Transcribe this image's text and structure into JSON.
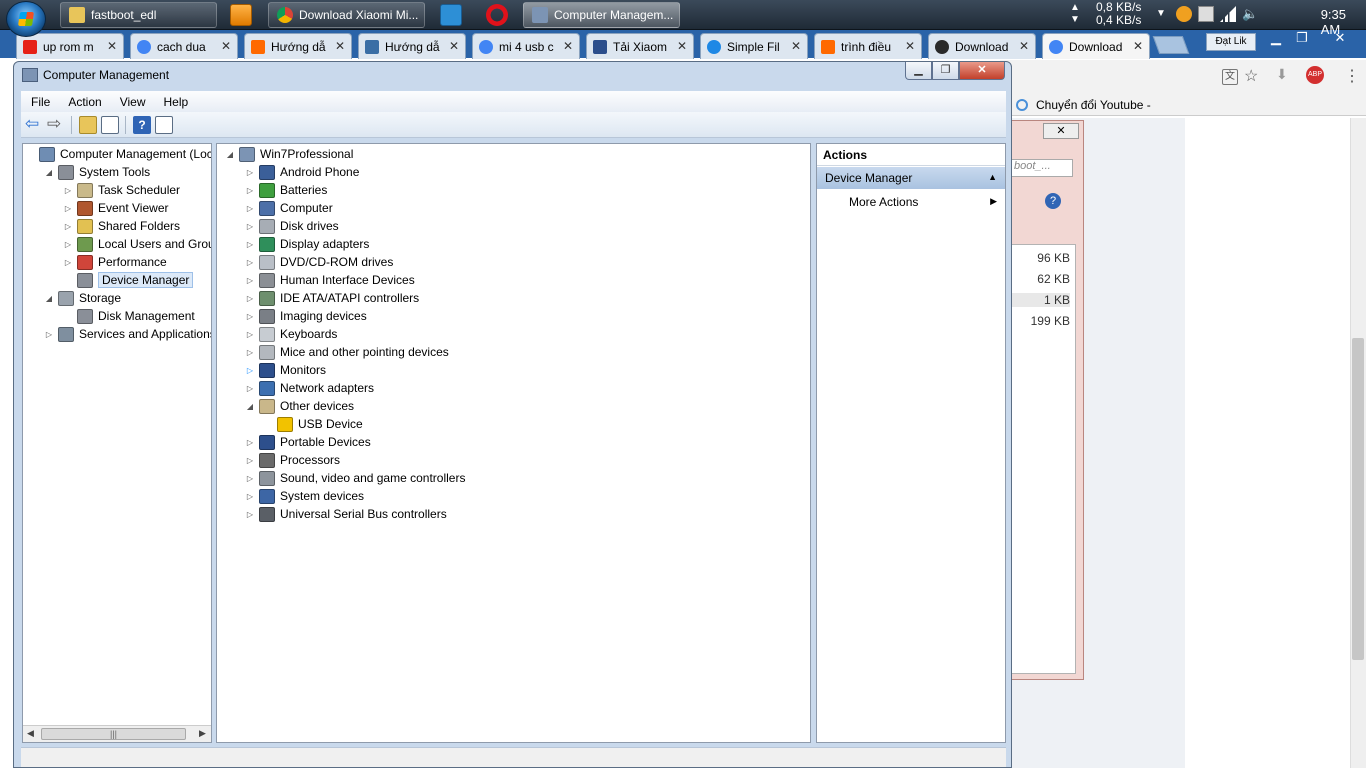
{
  "taskbar": {
    "buttons": [
      {
        "label": "fastboot_edl"
      },
      {
        "label": ""
      },
      {
        "label": "Download Xiaomi Mi..."
      },
      {
        "label": ""
      },
      {
        "label": ""
      },
      {
        "label": "Computer Managem..."
      }
    ],
    "net_up": "0,8 KB/s",
    "net_down": "0,4 KB/s",
    "clock": "9:35 AM"
  },
  "chrome": {
    "tabs": [
      {
        "label": "up rom m",
        "color": "#e62117"
      },
      {
        "label": "cach dua",
        "color": "#4285f4"
      },
      {
        "label": "Hướng dẫ",
        "color": "#ff6900"
      },
      {
        "label": "Hướng dẫ",
        "color": "#3a6ea5"
      },
      {
        "label": "mi 4 usb c",
        "color": "#4285f4"
      },
      {
        "label": "Tải Xiaom",
        "color": "#2b4e8c"
      },
      {
        "label": "Simple Fil",
        "color": "#1e88e5"
      },
      {
        "label": "trình điều",
        "color": "#ff6900"
      },
      {
        "label": "Download",
        "color": "#2a2a2a"
      },
      {
        "label": "Download",
        "color": "#4285f4"
      }
    ],
    "user_button": "Đạt Lik",
    "bookmark": "Chuyển đổi Youtube -",
    "search_partial": "boot_...",
    "file_sizes": [
      "96 KB",
      "62 KB",
      "1 KB",
      "199 KB"
    ]
  },
  "window": {
    "title": "Computer Management",
    "menu": [
      "File",
      "Action",
      "View",
      "Help"
    ]
  },
  "left_tree": [
    {
      "label": "Computer Management (Local",
      "level": 0,
      "expander": "",
      "icon_color": "#6f8db3"
    },
    {
      "label": "System Tools",
      "level": 1,
      "expander": "◢",
      "icon_color": "#8a8f98"
    },
    {
      "label": "Task Scheduler",
      "level": 2,
      "expander": "▷",
      "icon_color": "#c9b98a"
    },
    {
      "label": "Event Viewer",
      "level": 2,
      "expander": "▷",
      "icon_color": "#b0572f"
    },
    {
      "label": "Shared Folders",
      "level": 2,
      "expander": "▷",
      "icon_color": "#e2c152"
    },
    {
      "label": "Local Users and Groups",
      "level": 2,
      "expander": "▷",
      "icon_color": "#6e9a4e"
    },
    {
      "label": "Performance",
      "level": 2,
      "expander": "▷",
      "icon_color": "#d0453a"
    },
    {
      "label": "Device Manager",
      "level": 2,
      "expander": "",
      "icon_color": "#8a8f98",
      "selected": true
    },
    {
      "label": "Storage",
      "level": 1,
      "expander": "◢",
      "icon_color": "#9aa3ad"
    },
    {
      "label": "Disk Management",
      "level": 2,
      "expander": "",
      "icon_color": "#8a8f98"
    },
    {
      "label": "Services and Applications",
      "level": 1,
      "expander": "▷",
      "icon_color": "#7f8f9f"
    }
  ],
  "device_tree": {
    "root": "Win7Professional",
    "items": [
      {
        "label": "Android Phone",
        "level": 1,
        "expander": "▷",
        "icon_color": "#3b5f99"
      },
      {
        "label": "Batteries",
        "level": 1,
        "expander": "▷",
        "icon_color": "#3f9f3f"
      },
      {
        "label": "Computer",
        "level": 1,
        "expander": "▷",
        "icon_color": "#4c6fa8"
      },
      {
        "label": "Disk drives",
        "level": 1,
        "expander": "▷",
        "icon_color": "#a7adb5"
      },
      {
        "label": "Display adapters",
        "level": 1,
        "expander": "▷",
        "icon_color": "#2f8f5b"
      },
      {
        "label": "DVD/CD-ROM drives",
        "level": 1,
        "expander": "▷",
        "icon_color": "#b9bfc7"
      },
      {
        "label": "Human Interface Devices",
        "level": 1,
        "expander": "▷",
        "icon_color": "#8b8f95"
      },
      {
        "label": "IDE ATA/ATAPI controllers",
        "level": 1,
        "expander": "▷",
        "icon_color": "#6e8f6e"
      },
      {
        "label": "Imaging devices",
        "level": 1,
        "expander": "▷",
        "icon_color": "#7a7f86"
      },
      {
        "label": "Keyboards",
        "level": 1,
        "expander": "▷",
        "icon_color": "#c7ccd2"
      },
      {
        "label": "Mice and other pointing devices",
        "level": 1,
        "expander": "▷",
        "icon_color": "#b3b8be"
      },
      {
        "label": "Monitors",
        "level": 1,
        "expander": "▷",
        "icon_color": "#2d4f8c",
        "expander_color": "#1e90ff"
      },
      {
        "label": "Network adapters",
        "level": 1,
        "expander": "▷",
        "icon_color": "#3c6fb0"
      },
      {
        "label": "Other devices",
        "level": 1,
        "expander": "◢",
        "icon_color": "#c9b78a"
      },
      {
        "label": "USB Device",
        "level": 2,
        "expander": "",
        "icon_color": "#f2c200"
      },
      {
        "label": "Portable Devices",
        "level": 1,
        "expander": "▷",
        "icon_color": "#2d4f8c"
      },
      {
        "label": "Processors",
        "level": 1,
        "expander": "▷",
        "icon_color": "#6a6a6a"
      },
      {
        "label": "Sound, video and game controllers",
        "level": 1,
        "expander": "▷",
        "icon_color": "#8d949c"
      },
      {
        "label": "System devices",
        "level": 1,
        "expander": "▷",
        "icon_color": "#3d66a5"
      },
      {
        "label": "Universal Serial Bus controllers",
        "level": 1,
        "expander": "▷",
        "icon_color": "#5a5f66"
      }
    ]
  },
  "actions": {
    "header": "Actions",
    "group": "Device Manager",
    "item": "More Actions"
  }
}
